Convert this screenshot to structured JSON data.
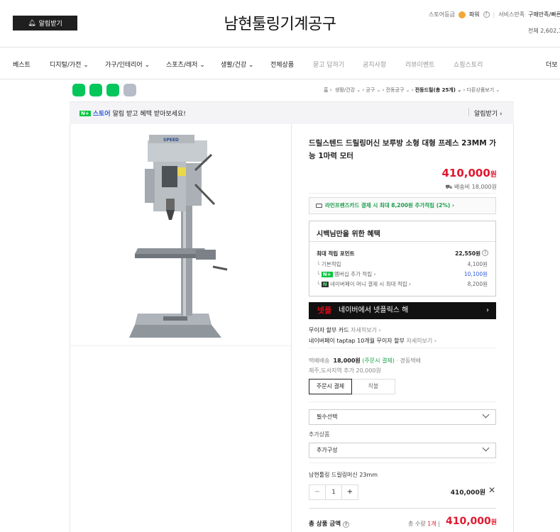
{
  "header": {
    "alarm_button": "알림받기",
    "store_title": "남현툴링기계공구",
    "store_grade_label": "스토어등급",
    "store_grade_value": "파워",
    "service_label": "서비스만족",
    "service_value": "구매만족/빠른배송",
    "total_label": "전체 2,602,19"
  },
  "nav": {
    "items": [
      {
        "label": "베스트"
      },
      {
        "label": "디지털/가전 ⌄"
      },
      {
        "label": "가구/인테리어 ⌄"
      },
      {
        "label": "스포츠/레저 ⌄"
      },
      {
        "label": "생활/건강 ⌄"
      },
      {
        "label": "전체상품"
      },
      {
        "label": "묻고 답하기"
      },
      {
        "label": "공지사항"
      },
      {
        "label": "리뷰이벤트"
      },
      {
        "label": "쇼핑스토리"
      },
      {
        "label": "더보"
      }
    ]
  },
  "breadcrumb": {
    "items": [
      "홈 ›",
      "생활/건강 ⌄",
      "공구 ⌄",
      "전동공구 ⌄"
    ],
    "current": "전동드릴(총 25개) ⌄",
    "more": "다른상품보기 ⌄"
  },
  "notice": {
    "badge": "N+",
    "store_word": "스토어",
    "text": "알림 받고 혜택 받아보세요!",
    "right_button": "알림받기 ›"
  },
  "product": {
    "title": "드릴스텐드 드릴링머신 보루방 소형 대형 프레스 23MM 가능 1마력 모터",
    "price": "410,000",
    "price_unit": "원",
    "shipping": "배송비 18,000원"
  },
  "card_promo": "라인프렌즈카드 결제 시 최대 8,200원 추가적립 (2%) ›",
  "benefit": {
    "title": "시백님만을 위한 혜택",
    "max_points_label": "최대 적립 포인트",
    "max_points_value": "22,550원",
    "basic_label": "기본적립",
    "basic_value": "4,100원",
    "membership_label": "멤버십 추가 적립 ›",
    "membership_value": "10,100원",
    "naverpay_label": "네이버페이 머니 결제 시 최대 적립 ›",
    "naverpay_value": "8,200원"
  },
  "netflix": {
    "logo": "넷플",
    "text": "네이버에서 넷플릭스 해",
    "chevron": "›"
  },
  "installment": {
    "card_label": "무이자 할부 카드",
    "card_link": "자세히보기 ›",
    "taptap": "네이버페이 taptap 10개월 무이자 할부",
    "taptap_link": "자세히보기 ›"
  },
  "delivery": {
    "label": "택배배송",
    "fee": "18,000원",
    "note": "(주문시 결제)",
    "carrier": "· 경동택배",
    "extra": "제주,도서지역 추가 20,000원",
    "pay_on_order": "주문시 결제",
    "pay_on_delivery": "착불"
  },
  "options": {
    "required": "필수선택",
    "addon_label": "추가상품",
    "addon": "추가구성"
  },
  "selected": {
    "name": "남현툴링 드릴링머신 23mm",
    "minus": "−",
    "qty": "1",
    "plus": "+",
    "price": "410,000원",
    "remove": "✕"
  },
  "total": {
    "label": "총 상품 금액",
    "qty_label": "총 수량",
    "qty_value": "1개",
    "price": "410,000",
    "unit": "원"
  },
  "colors": {
    "accent_red": "#e0182f",
    "naver_green": "#00c73c",
    "link_blue": "#2b5ad6"
  }
}
